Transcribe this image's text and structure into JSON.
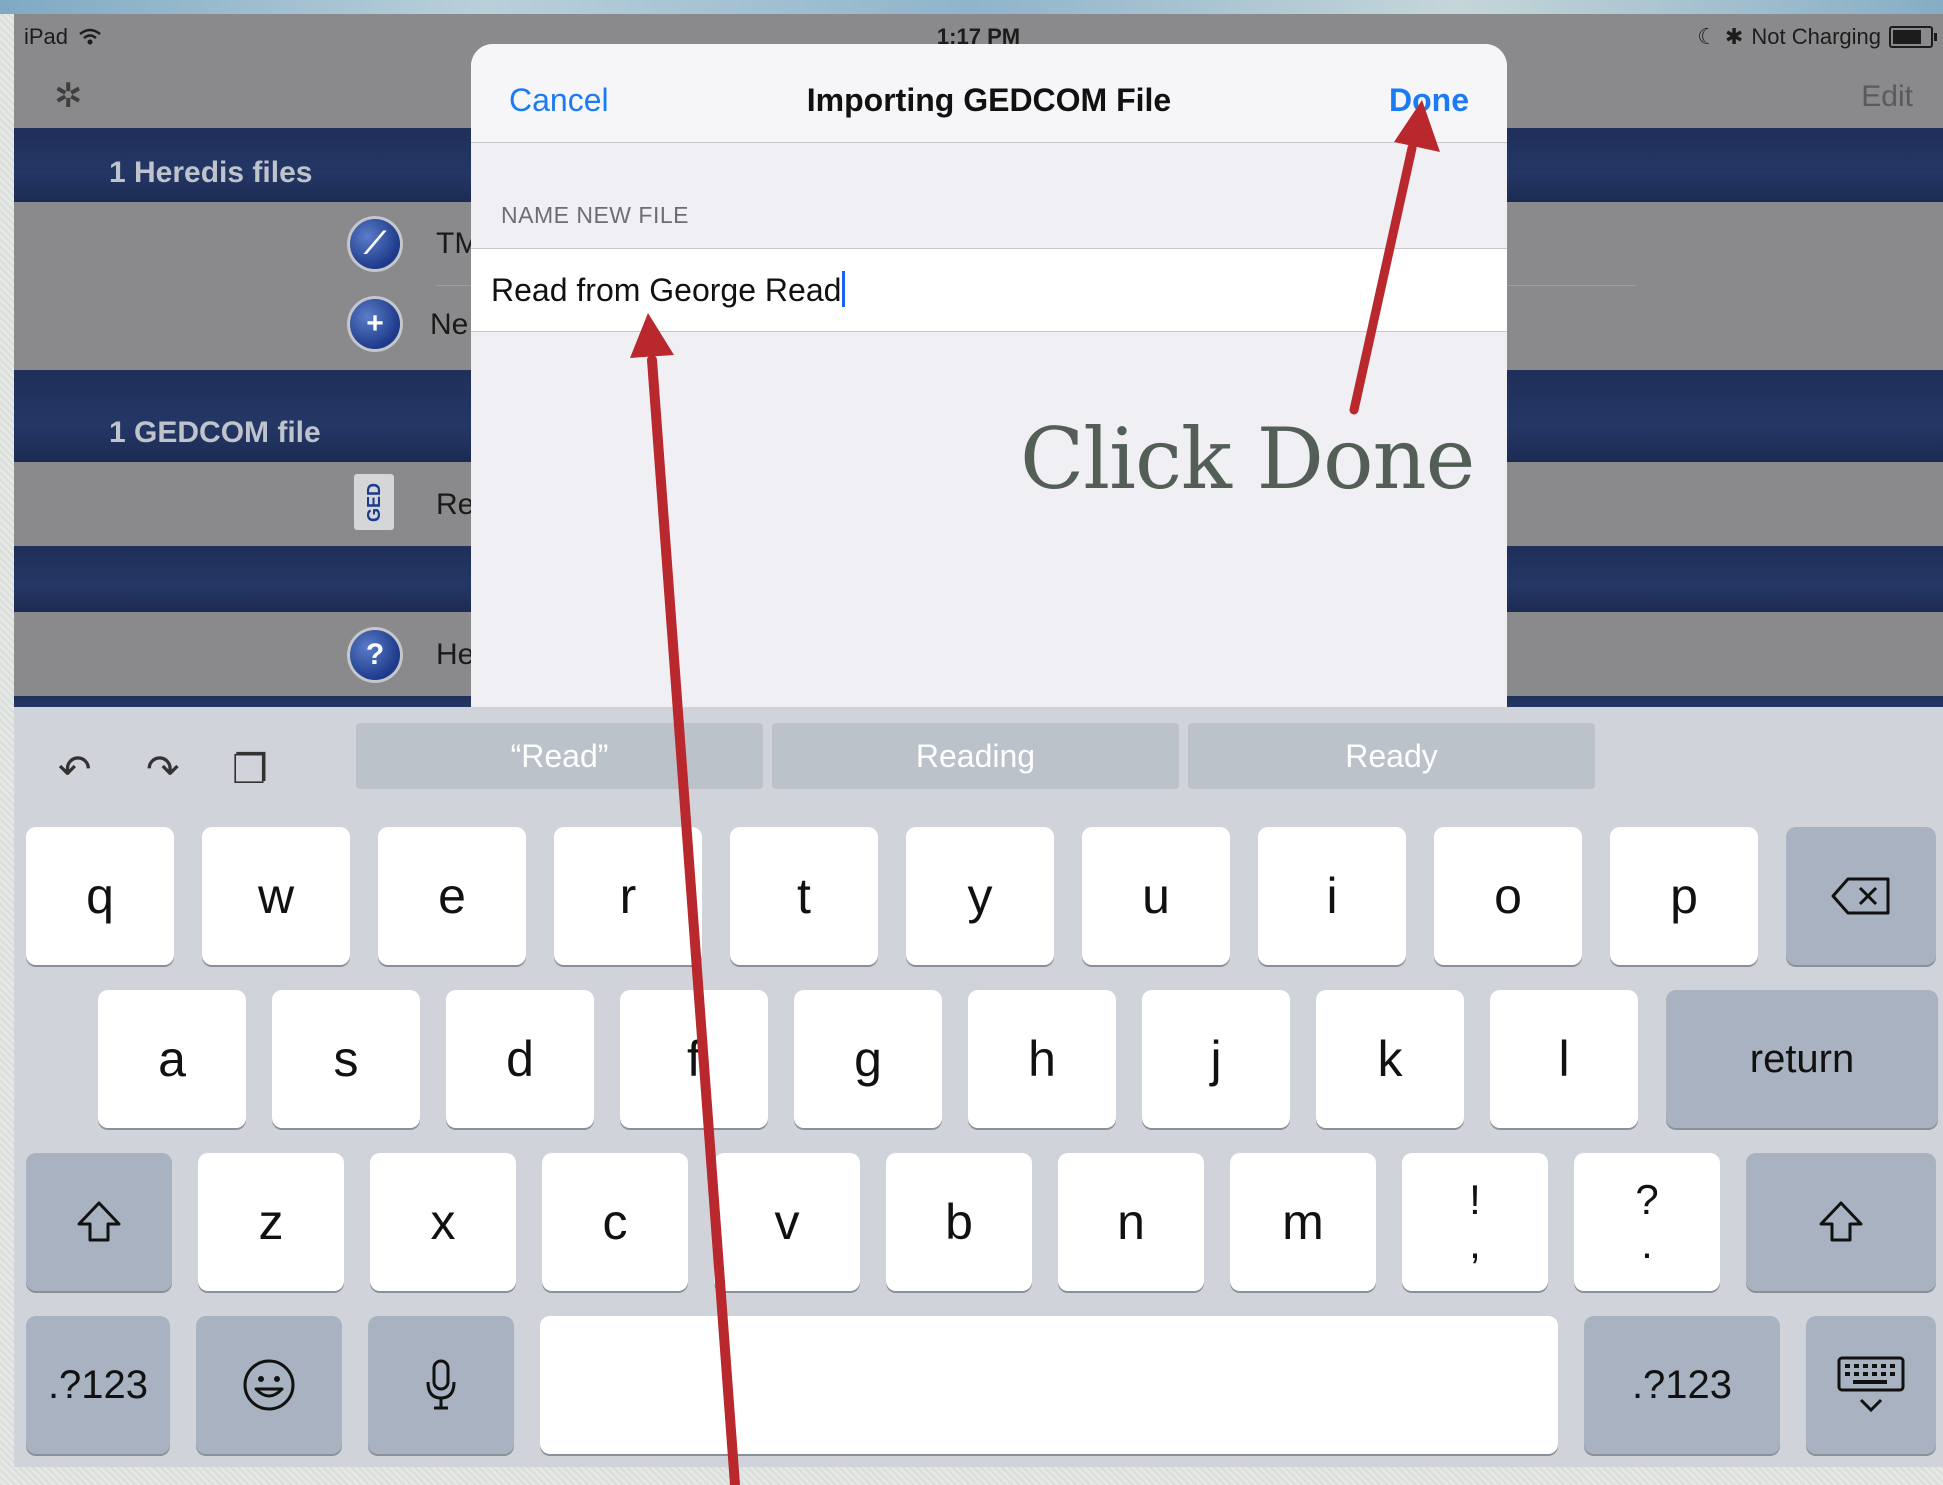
{
  "status": {
    "device": "iPad",
    "time": "1:17 PM",
    "charging": "Not Charging"
  },
  "background_app": {
    "edit_label": "Edit",
    "sections": [
      {
        "header": "1 Heredis files",
        "rows": [
          {
            "label": "TM",
            "icon": "leaf-icon"
          },
          {
            "label": "Ne",
            "icon": "plus-icon"
          }
        ]
      },
      {
        "header": "1 GEDCOM file",
        "rows": [
          {
            "label": "Re",
            "icon": "ged-file-icon"
          }
        ]
      },
      {
        "header": "",
        "rows": [
          {
            "label": "He",
            "icon": "question-icon"
          }
        ]
      }
    ]
  },
  "modal": {
    "cancel_label": "Cancel",
    "title": "Importing GEDCOM File",
    "done_label": "Done",
    "field_label": "NAME NEW FILE",
    "field_value": "Read from George Read"
  },
  "annotation": {
    "text": "Click Done",
    "color": "#b8282c"
  },
  "keyboard": {
    "suggestions": [
      "“Read”",
      "Reading",
      "Ready"
    ],
    "row1": [
      "q",
      "w",
      "e",
      "r",
      "t",
      "y",
      "u",
      "i",
      "o",
      "p"
    ],
    "row2": [
      "a",
      "s",
      "d",
      "f",
      "g",
      "h",
      "j",
      "k",
      "l"
    ],
    "return_label": "return",
    "row3": [
      "z",
      "x",
      "c",
      "v",
      "b",
      "n",
      "m"
    ],
    "punct1": {
      "top": "!",
      "bottom": ","
    },
    "punct2": {
      "top": "?",
      "bottom": "."
    },
    "numbers_label": ".?123"
  },
  "colors": {
    "accent": "#1b7bf5",
    "header_band": "#243765"
  }
}
